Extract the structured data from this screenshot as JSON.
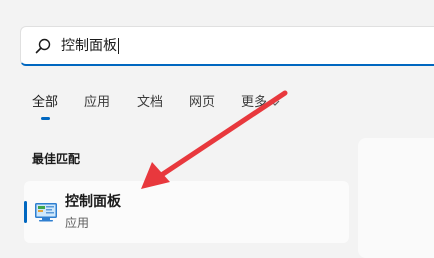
{
  "search": {
    "value": "控制面板",
    "icon": "search-icon"
  },
  "tabs": [
    {
      "label": "全部",
      "active": true
    },
    {
      "label": "应用",
      "active": false
    },
    {
      "label": "文档",
      "active": false
    },
    {
      "label": "网页",
      "active": false
    },
    {
      "label": "更多",
      "active": false,
      "has_dropdown": true
    }
  ],
  "results": {
    "section_title": "最佳匹配",
    "best_match": {
      "name": "控制面板",
      "type": "应用",
      "icon": "control-panel-icon"
    }
  },
  "annotation": {
    "type": "red-arrow",
    "color": "#e8383d"
  },
  "colors": {
    "accent": "#0067c0",
    "background": "#f3f3f3"
  }
}
